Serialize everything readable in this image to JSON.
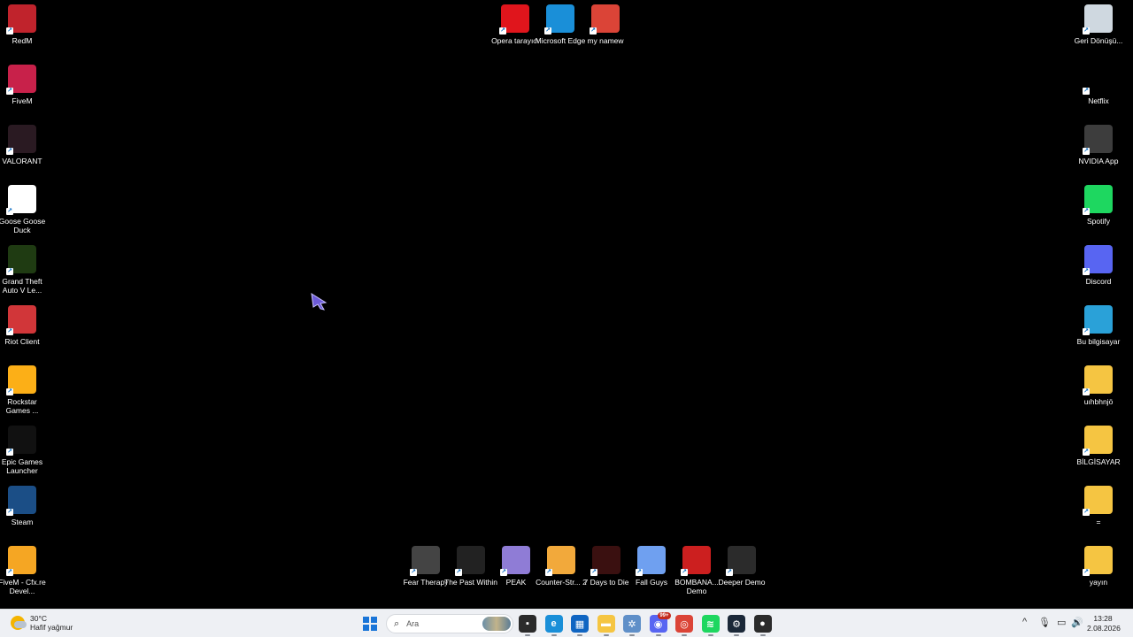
{
  "desktop": {
    "left_icons": [
      {
        "label": "RedM",
        "icon": "redm-icon",
        "color": "#c0232c"
      },
      {
        "label": "FiveM",
        "icon": "fivem-icon",
        "color": "#c8214a"
      },
      {
        "label": "VALORANT",
        "icon": "valorant-icon",
        "color": "#2a1a22"
      },
      {
        "label": "Goose Goose Duck",
        "icon": "goose-icon",
        "color": "#ffffff"
      },
      {
        "label": "Grand Theft Auto V Le...",
        "icon": "gta-icon",
        "color": "#1f3b12"
      },
      {
        "label": "Riot Client",
        "icon": "riot-icon",
        "color": "#d13639"
      },
      {
        "label": "Rockstar Games ...",
        "icon": "rockstar-icon",
        "color": "#fcaf17"
      },
      {
        "label": "Epic Games Launcher",
        "icon": "epic-icon",
        "color": "#111111"
      },
      {
        "label": "Steam",
        "icon": "steam-icon",
        "color": "#1b4e86"
      },
      {
        "label": "FiveM - Cfx.re Devel...",
        "icon": "cfx-icon",
        "color": "#f5a623"
      }
    ],
    "top_icons": [
      {
        "label": "Opera tarayıcı",
        "icon": "opera-icon",
        "color": "#e0151c"
      },
      {
        "label": "Microsoft Edge",
        "icon": "edge-icon",
        "color": "#1a8fd8"
      },
      {
        "label": "my namew",
        "icon": "chrome-icon",
        "color": "#db4437"
      }
    ],
    "right_icons": [
      {
        "label": "Geri Dönüşü...",
        "icon": "recycle-bin-icon",
        "color": "#cfd8e0"
      },
      {
        "label": "Netflix",
        "icon": "netflix-icon",
        "color": "#000000"
      },
      {
        "label": "NVIDIA App",
        "icon": "nvidia-icon",
        "color": "#3d3d3d"
      },
      {
        "label": "Spotify",
        "icon": "spotify-icon",
        "color": "#1ed760"
      },
      {
        "label": "Discord",
        "icon": "discord-icon",
        "color": "#5865f2"
      },
      {
        "label": "Bu bilgisayar",
        "icon": "this-pc-icon",
        "color": "#2aa1d8"
      },
      {
        "label": "uıhbhnjö",
        "icon": "folder-icon",
        "color": "#f5c542"
      },
      {
        "label": "BİLGİSAYAR",
        "icon": "folder-icon",
        "color": "#f5c542"
      },
      {
        "label": "=",
        "icon": "folder-icon",
        "color": "#f5c542"
      },
      {
        "label": "yayın",
        "icon": "folder-icon",
        "color": "#f5c542"
      }
    ],
    "bottom_icons": [
      {
        "label": "Fear Therapy",
        "icon": "fear-therapy-icon",
        "color": "#444444"
      },
      {
        "label": "The Past Within",
        "icon": "past-within-icon",
        "color": "#222222"
      },
      {
        "label": "PEAK",
        "icon": "peak-icon",
        "color": "#8f7cd6"
      },
      {
        "label": "Counter-Str... 2",
        "icon": "cs2-icon",
        "color": "#f2a93b"
      },
      {
        "label": "7 Days to Die",
        "icon": "7days-icon",
        "color": "#3a1010"
      },
      {
        "label": "Fall Guys",
        "icon": "fall-guys-icon",
        "color": "#6fa0f0"
      },
      {
        "label": "BOMBANA... Demo",
        "icon": "bombana-icon",
        "color": "#cc1f1f"
      },
      {
        "label": "Deeper Demo",
        "icon": "deeper-icon",
        "color": "#2b2b2b"
      }
    ]
  },
  "taskbar": {
    "weather": {
      "temp": "30°C",
      "desc": "Hafif yağmur"
    },
    "search_placeholder": "Ara",
    "apps": [
      {
        "name": "task-view",
        "glyph": "▪",
        "color": "#2b2b2b"
      },
      {
        "name": "edge",
        "glyph": "e",
        "color": "#1a8fd8"
      },
      {
        "name": "store",
        "glyph": "▦",
        "color": "#1065c2"
      },
      {
        "name": "file-explorer",
        "glyph": "▬",
        "color": "#f5c542"
      },
      {
        "name": "settings-app",
        "glyph": "✲",
        "color": "#5f8fc8"
      },
      {
        "name": "discord",
        "glyph": "◉",
        "color": "#5865f2",
        "badge": "99+"
      },
      {
        "name": "chrome",
        "glyph": "◎",
        "color": "#db4437"
      },
      {
        "name": "spotify",
        "glyph": "≋",
        "color": "#1ed760"
      },
      {
        "name": "steam",
        "glyph": "⚙",
        "color": "#1b2838"
      },
      {
        "name": "riot",
        "glyph": "●",
        "color": "#2b2b2b"
      }
    ],
    "tray": {
      "chevron": "^",
      "mic": "🎙",
      "network": "▭",
      "volume": "🔊"
    },
    "clock": {
      "time": "13:28",
      "date": "2.08.2026"
    }
  }
}
